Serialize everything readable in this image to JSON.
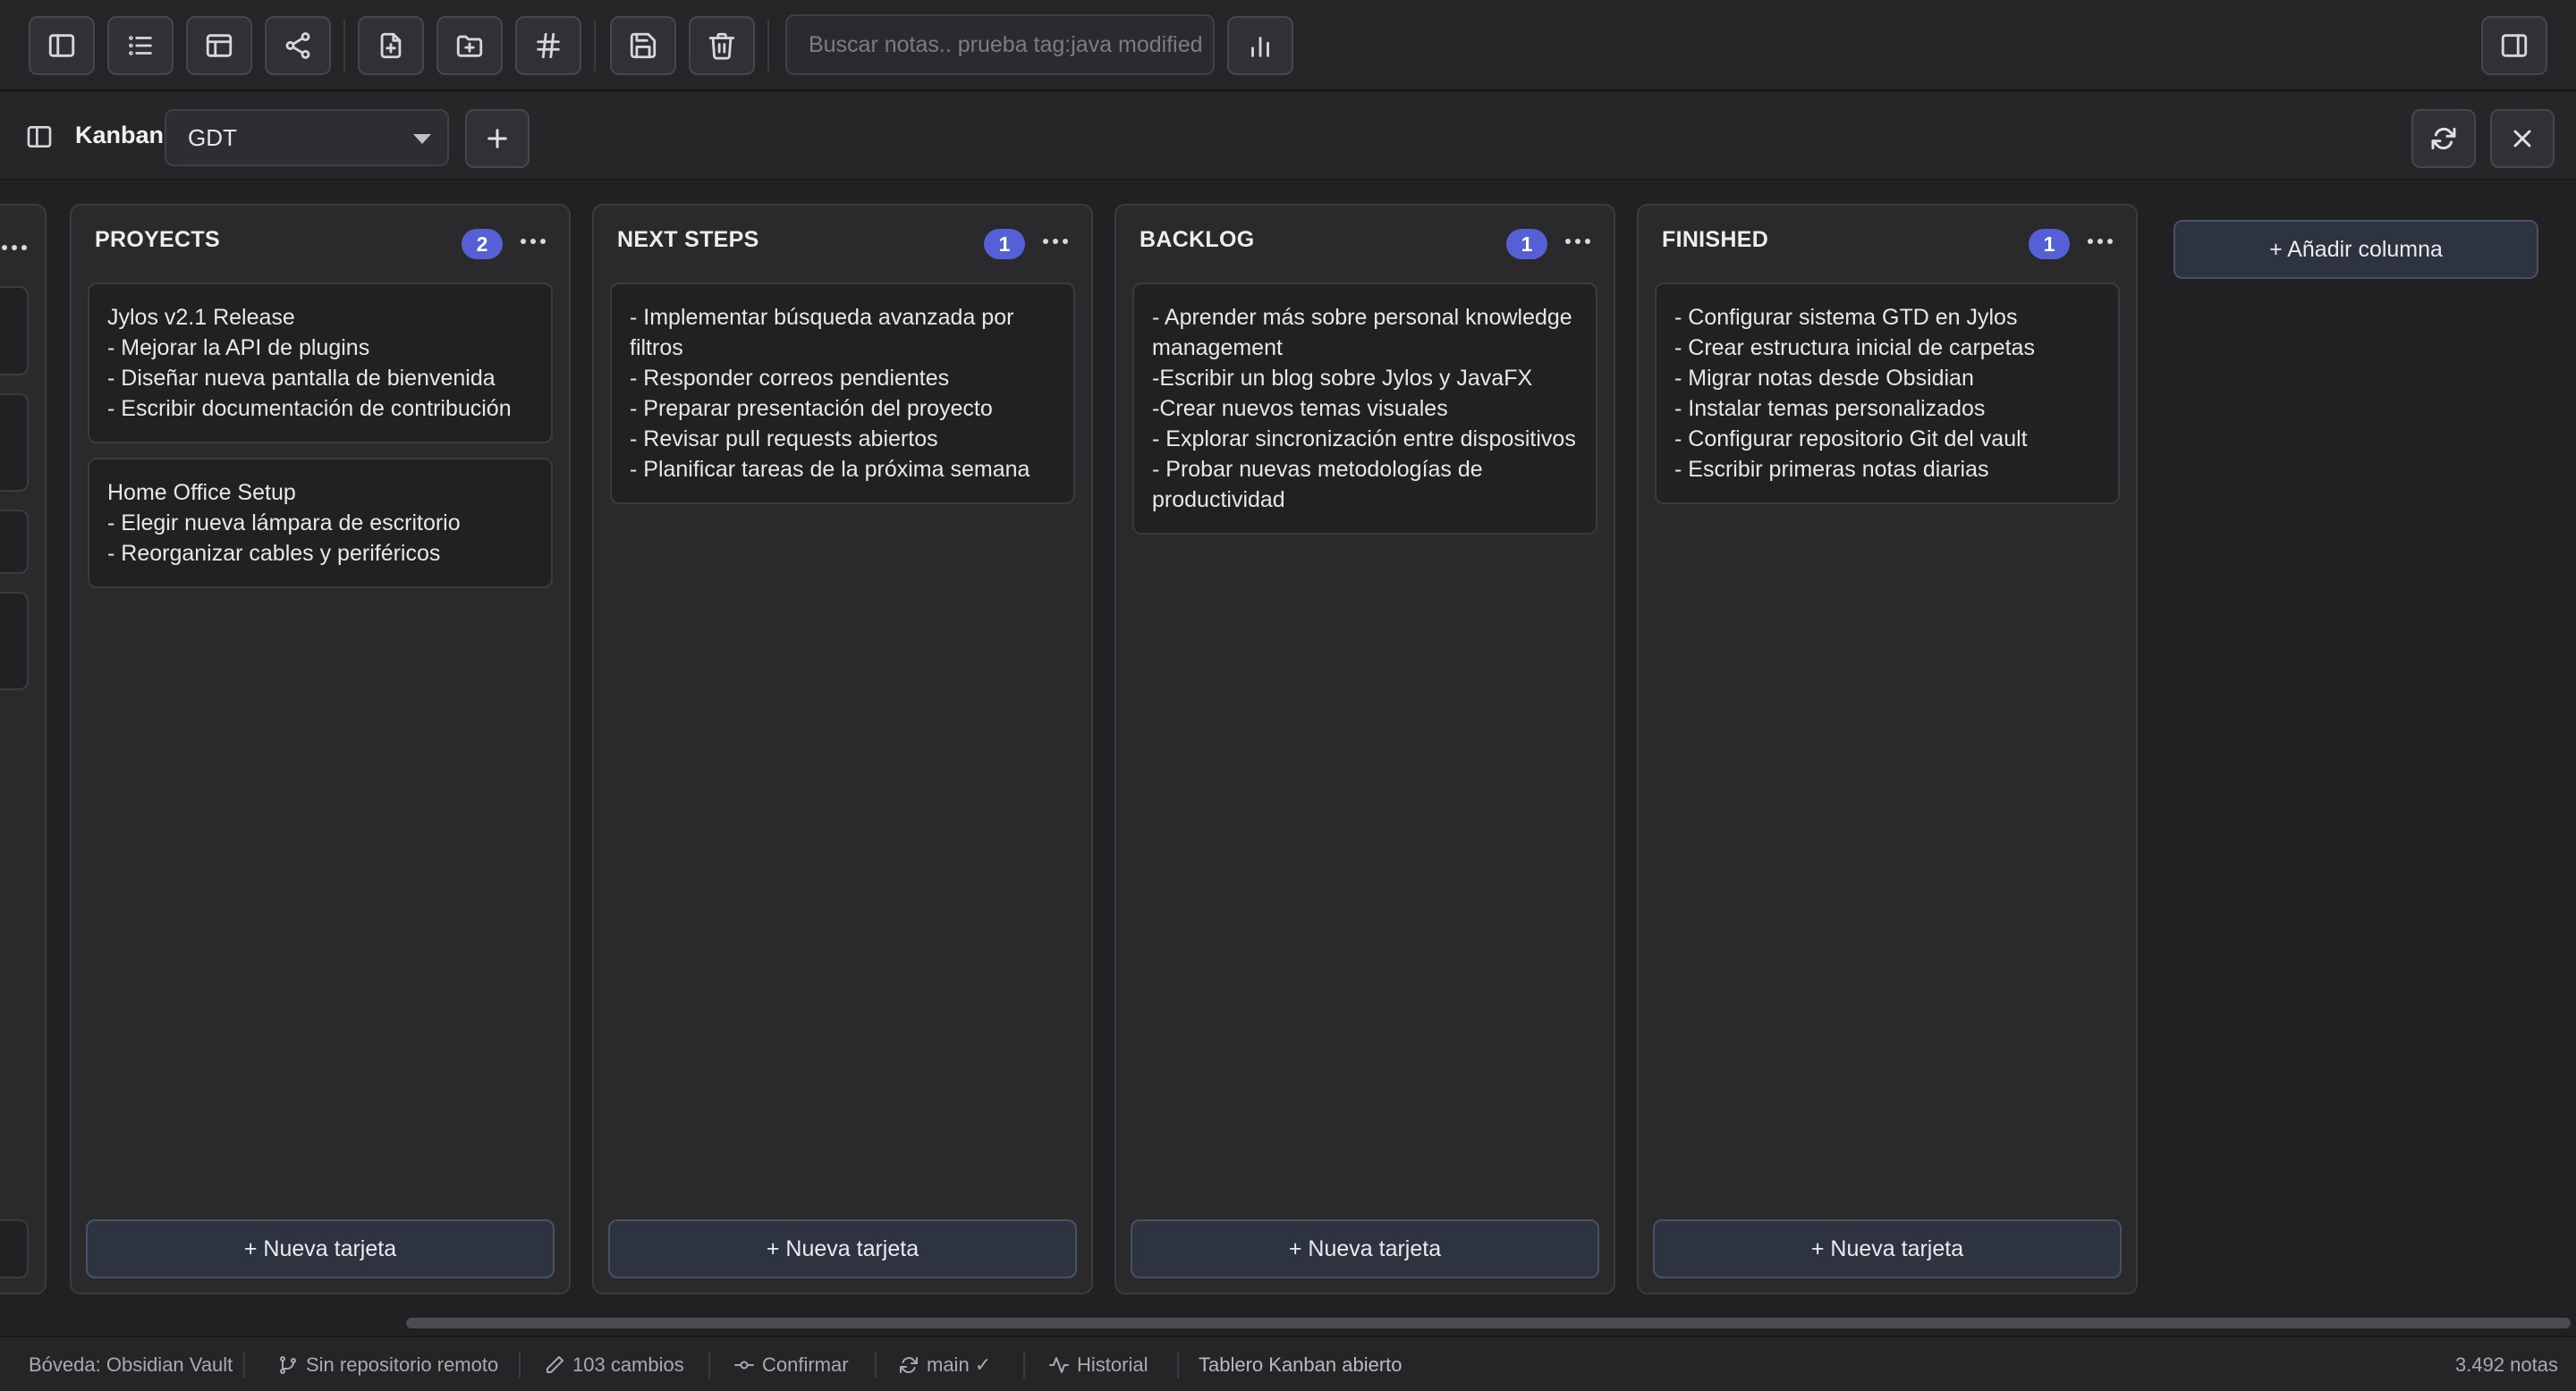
{
  "toolbar": {
    "buttons": [
      {
        "name": "toggle-sidebar",
        "icon": "sidebar-left-icon"
      },
      {
        "name": "list-view",
        "icon": "list-icon"
      },
      {
        "name": "layout",
        "icon": "layout-icon"
      },
      {
        "name": "graph",
        "icon": "share-graph-icon"
      },
      {
        "name": "new-note",
        "icon": "file-plus-icon"
      },
      {
        "name": "new-folder",
        "icon": "folder-plus-icon"
      },
      {
        "name": "tags",
        "icon": "hash-icon"
      },
      {
        "name": "save",
        "icon": "save-icon"
      },
      {
        "name": "delete",
        "icon": "trash-icon"
      },
      {
        "name": "stats",
        "icon": "bar-chart-icon"
      },
      {
        "name": "toggle-right-panel",
        "icon": "sidebar-right-icon"
      }
    ],
    "search_placeholder": "Buscar notas.. prueba tag:java modified"
  },
  "kanban_bar": {
    "title": "Kanban",
    "board_selected": "GDT"
  },
  "columns": [
    {
      "title": "PROYECTS",
      "count": "2",
      "cards": [
        "Jylos v2.1 Release\n- Mejorar la API de plugins\n- Diseñar nueva pantalla de bienvenida\n- Escribir documentación de contribución",
        "Home Office Setup\n- Elegir nueva lámpara de escritorio\n- Reorganizar cables y periféricos"
      ],
      "new_card": "+ Nueva tarjeta"
    },
    {
      "title": "NEXT STEPS",
      "count": "1",
      "cards": [
        "- Implementar búsqueda avanzada por filtros\n- Responder correos pendientes\n- Preparar presentación del proyecto\n- Revisar pull requests abiertos\n- Planificar tareas de la próxima semana"
      ],
      "new_card": "+ Nueva tarjeta"
    },
    {
      "title": "BACKLOG",
      "count": "1",
      "cards": [
        "- Aprender más sobre personal knowledge management\n-Escribir un blog sobre Jylos y JavaFX\n-Crear nuevos temas visuales\n- Explorar sincronización entre dispositivos\n- Probar nuevas metodologías de productividad"
      ],
      "new_card": "+ Nueva tarjeta"
    },
    {
      "title": "FINISHED",
      "count": "1",
      "cards": [
        "- Configurar sistema GTD en Jylos\n- Crear estructura inicial de carpetas\n- Migrar notas desde Obsidian\n- Instalar temas personalizados\n- Configurar repositorio Git del vault\n- Escribir primeras notas diarias"
      ],
      "new_card": "+ Nueva tarjeta"
    }
  ],
  "add_column": "+ Añadir columna",
  "status_bar": {
    "vault": "Bóveda: Obsidian Vault",
    "remote": "Sin repositorio remoto",
    "changes": "103 cambios",
    "commit": "Confirmar",
    "branch": "main ✓",
    "history": "Historial",
    "message": "Tablero Kanban abierto",
    "notes_count": "3.492 notas"
  },
  "colors": {
    "accent_badge": "#5660d6",
    "background": "#212123",
    "panel": "#2a2a2c"
  }
}
